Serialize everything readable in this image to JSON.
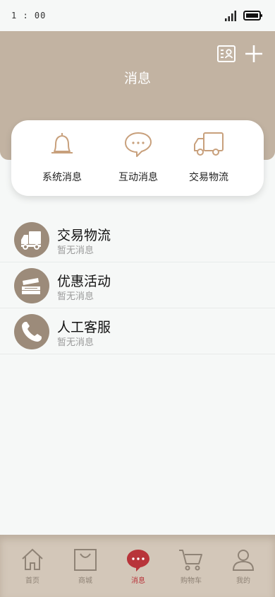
{
  "status_bar": {
    "time": "1 : 00"
  },
  "header": {
    "title": "消息"
  },
  "quick_actions": [
    {
      "label": "系统消息",
      "icon": "bell-icon"
    },
    {
      "label": "互动消息",
      "icon": "chat-bubble-icon"
    },
    {
      "label": "交易物流",
      "icon": "truck-icon"
    }
  ],
  "messages": [
    {
      "title": "交易物流",
      "subtitle": "暂无消息",
      "icon": "truck-icon"
    },
    {
      "title": "优惠活动",
      "subtitle": "暂无消息",
      "icon": "coupon-icon"
    },
    {
      "title": "人工客服",
      "subtitle": "暂无消息",
      "icon": "phone-icon"
    }
  ],
  "tabbar": {
    "items": [
      {
        "label": "首页",
        "icon": "home-icon"
      },
      {
        "label": "商城",
        "icon": "shopping-bag-icon"
      },
      {
        "label": "消息",
        "icon": "message-icon",
        "active": true
      },
      {
        "label": "购物车",
        "icon": "cart-icon"
      },
      {
        "label": "我的",
        "icon": "user-icon"
      }
    ]
  },
  "colors": {
    "header_bg": "#c2b3a2",
    "accent_icon": "#c8a07c",
    "avatar_bg": "#9c8b7a",
    "active_tab": "#b8343a",
    "tabbar_bg": "#d3c7b9"
  }
}
